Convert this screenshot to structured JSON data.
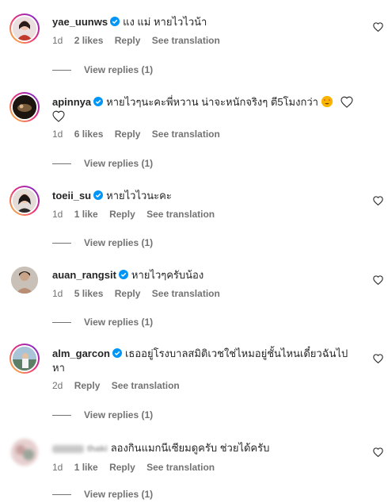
{
  "comments": [
    {
      "username": "yae_uunws",
      "text": "แง แม่ หายไวไวน้า",
      "time": "1d",
      "likes": "2 likes",
      "reply": "Reply",
      "see_translation": "See translation",
      "view_replies": "View replies (1)"
    },
    {
      "username": "apinnya",
      "text": "หายไวๆนะคะพี่หวาน น่าจะหนักจริงๆ ตี5โมงกว่า",
      "time": "1d",
      "likes": "6 likes",
      "reply": "Reply",
      "see_translation": "See translation",
      "view_replies": "View replies (1)"
    },
    {
      "username": "toeii_su",
      "text": "หายไวไวนะคะ",
      "time": "1d",
      "likes": "1 like",
      "reply": "Reply",
      "see_translation": "See translation",
      "view_replies": "View replies (1)"
    },
    {
      "username": "auan_rangsit",
      "text": "หายไวๆครับน้อง",
      "time": "1d",
      "likes": "5 likes",
      "reply": "Reply",
      "see_translation": "See translation",
      "view_replies": "View replies (1)"
    },
    {
      "username": "alm_garcon",
      "text": "เธออยู่โรงบาลสมิติเวชใช่ไหมอยู่ชั้นไหนเดี๋ยวฉันไปหา",
      "time": "2d",
      "reply": "Reply",
      "see_translation": "See translation",
      "view_replies": "View replies (1)"
    },
    {
      "username": "thaki",
      "text": "ลองกินแมกนีเซียมดูครับ ช่วยได้ครับ",
      "time": "1d",
      "likes": "1 like",
      "reply": "Reply",
      "see_translation": "See translation",
      "view_replies": "View replies (1)"
    }
  ],
  "icons": {
    "verified": "verified-badge-icon",
    "heart": "heart-outline-icon",
    "emoji": "heart-eyes-emoji"
  },
  "colors": {
    "verified_blue": "#0095f6",
    "meta_gray": "#737373",
    "text": "#262626"
  }
}
